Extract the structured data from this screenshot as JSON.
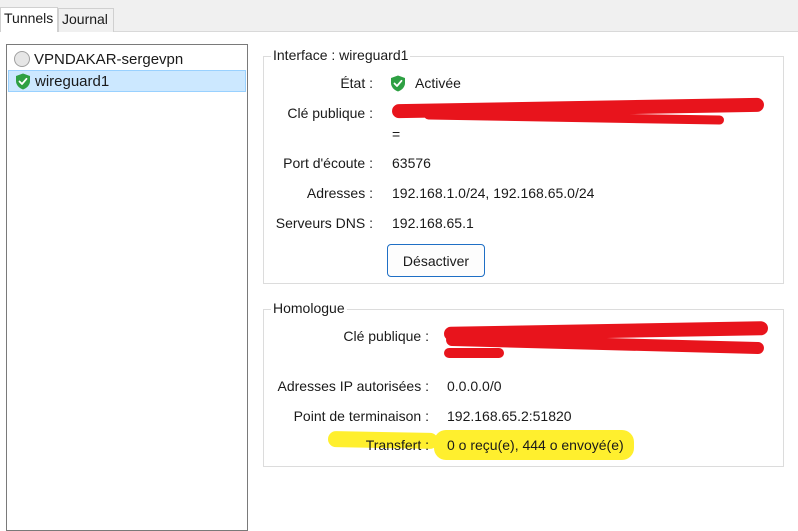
{
  "tabs": [
    {
      "label": "Tunnels",
      "active": true
    },
    {
      "label": "Journal",
      "active": false
    }
  ],
  "tunnels": [
    {
      "name": "VPNDAKAR-sergevpn",
      "status": "inactive",
      "icon": "circle-inactive-icon"
    },
    {
      "name": "wireguard1",
      "status": "active",
      "icon": "shield-check-icon",
      "selected": true
    }
  ],
  "interface": {
    "title": "Interface : wireguard1",
    "state_label": "État :",
    "state_value": "Activée",
    "pubkey_label": "Clé publique :",
    "pubkey_suffix": "=",
    "port_label": "Port d'écoute :",
    "port_value": "63576",
    "addresses_label": "Adresses :",
    "addresses_value": "192.168.1.0/24, 192.168.65.0/24",
    "dns_label": "Serveurs DNS :",
    "dns_value": "192.168.65.1",
    "deactivate_label": "Désactiver"
  },
  "peer": {
    "title": "Homologue",
    "pubkey_label": "Clé publique :",
    "allowed_ips_label": "Adresses IP autorisées :",
    "allowed_ips_value": "0.0.0.0/0",
    "endpoint_label": "Point de terminaison :",
    "endpoint_value": "192.168.65.2:51820",
    "transfer_label": "Transfert :",
    "transfer_value": "0 o reçu(e), 444 o envoyé(e)"
  },
  "colors": {
    "active_green": "#2ea043",
    "selection": "#cce8ff",
    "redaction": "#e8141c",
    "highlight": "#ffef2e",
    "button_border": "#1f6fc5"
  }
}
